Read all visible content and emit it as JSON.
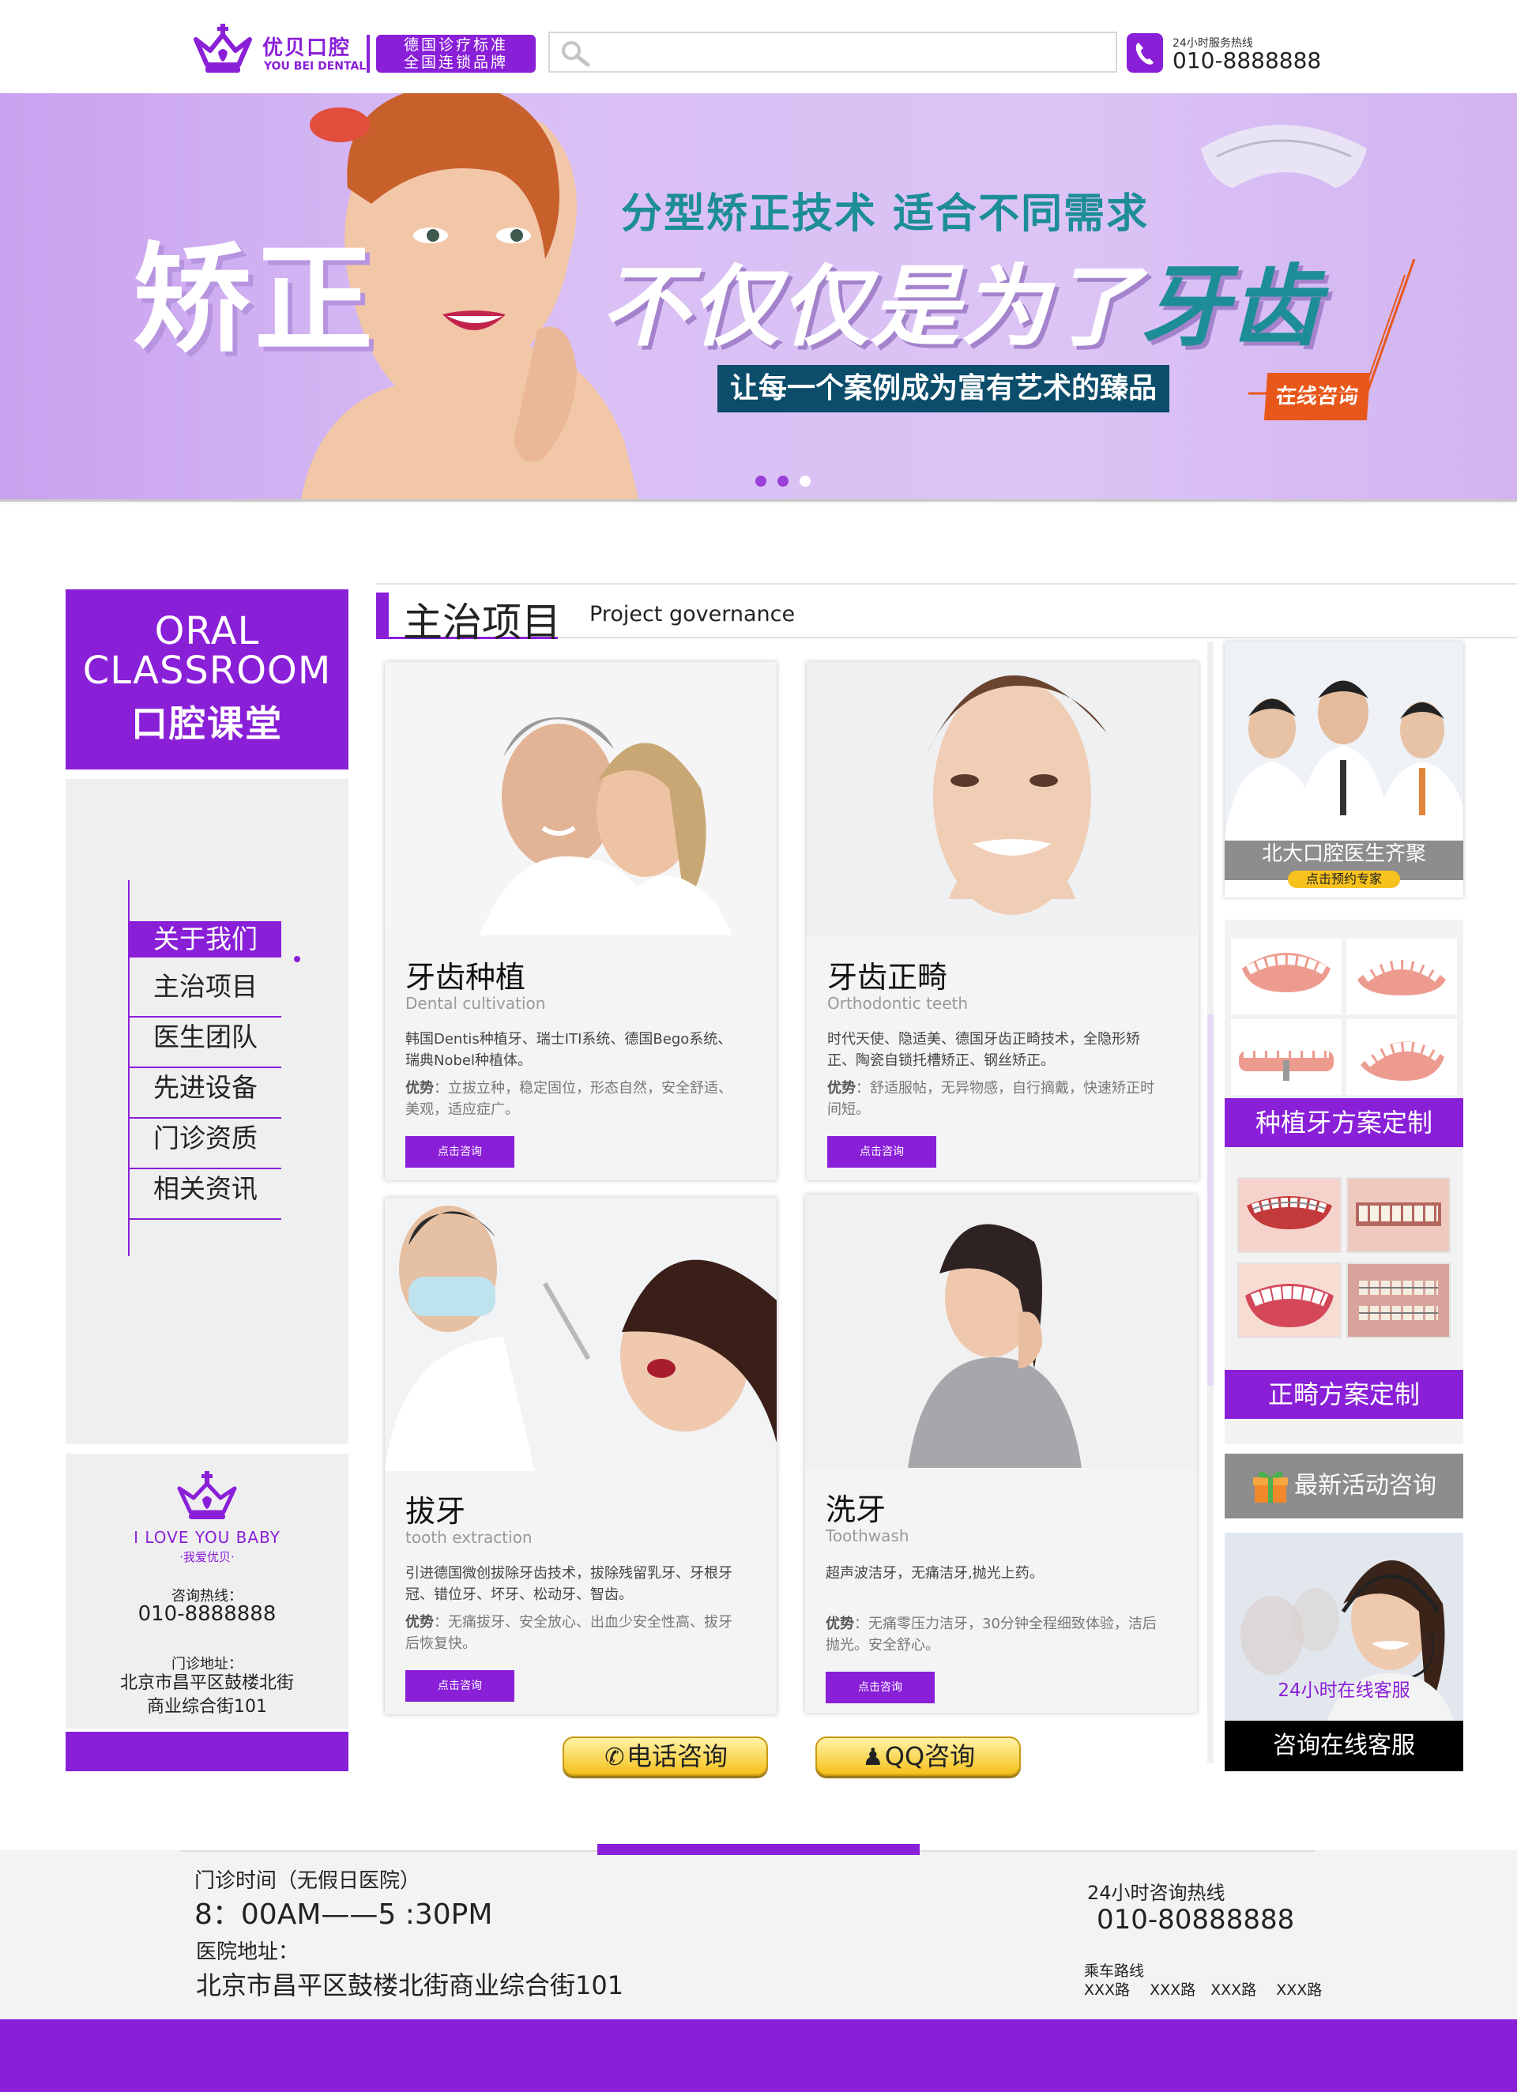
{
  "header": {
    "logo_cn": "优贝口腔",
    "logo_en": "YOU BEI DENTAL",
    "slogan_line1": "德国诊疗标准",
    "slogan_line2": "全国连锁品牌",
    "search_placeholder": "",
    "hotline_label": "24小时服务热线",
    "hotline_number": "010-8888888"
  },
  "banner": {
    "big_word": "矫正",
    "sub_title": "分型矫正技术 适合不同需求",
    "headline_a": "不仅仅是为了",
    "headline_b": "牙齿",
    "tagline": "让每一个案例成为富有艺术的臻品",
    "cta": "在线咨询",
    "slides": 3,
    "active_slide": 3
  },
  "sidebar": {
    "title_en_1": "ORAL",
    "title_en_2": "CLASSROOM",
    "title_cn": "口腔课堂",
    "nav": [
      {
        "label": "关于我们",
        "active": true
      },
      {
        "label": "主治项目",
        "active": false
      },
      {
        "label": "医生团队",
        "active": false
      },
      {
        "label": "先进设备",
        "active": false
      },
      {
        "label": "门诊资质",
        "active": false
      },
      {
        "label": "相关资讯",
        "active": false
      }
    ],
    "contact": {
      "love": "I LOVE YOU BABY",
      "love_cn": "·我爱优贝·",
      "hotline_label": "咨询热线：",
      "hotline": "010-8888888",
      "addr_label": "门诊地址：",
      "addr_line1": "北京市昌平区鼓楼北街",
      "addr_line2": "商业综合街101"
    }
  },
  "main": {
    "heading_cn": "主治项目",
    "heading_en": "Project governance",
    "cards": [
      {
        "title": "牙齿种植",
        "subtitle": "Dental cultivation",
        "desc": "韩国Dentis种植牙、瑞士ITI系统、德国Bego系统、瑞典Nobel种植体。",
        "adv_label": "优势",
        "adv": "：立拔立种，稳定固位，形态自然，安全舒适、美观，适应症广。",
        "button": "点击咨询"
      },
      {
        "title": "牙齿正畸",
        "subtitle": "Orthodontic teeth",
        "desc": "时代天使、隐适美、德国牙齿正畸技术，全隐形矫正、陶瓷自锁托槽矫正、钢丝矫正。",
        "adv_label": "优势",
        "adv": "：舒适服帖，无异物感，自行摘戴，快速矫正时间短。",
        "button": "点击咨询"
      },
      {
        "title": "拔牙",
        "subtitle": "tooth extraction",
        "desc": "引进德国微创拔除牙齿技术，拔除残留乳牙、牙根牙冠、错位牙、坏牙、松动牙、智齿。",
        "adv_label": "优势",
        "adv": "：无痛拔牙、安全放心、出血少安全性高、拔牙后恢复快。",
        "button": "点击咨询"
      },
      {
        "title": "洗牙",
        "subtitle": "Toothwash",
        "desc": "超声波洁牙，无痛洁牙,抛光上药。",
        "adv_label": "优势",
        "adv": "：无痛零压力洁牙，30分钟全程细致体验，洁后抛光。安全舒心。",
        "button": "点击咨询"
      }
    ],
    "phone_consult": "电话咨询",
    "qq_consult": "QQ咨询"
  },
  "right": {
    "doctors_label": "北大口腔医生齐聚",
    "doctors_pill": "点击预约专家",
    "implant_label": "种植牙方案定制",
    "ortho_label": "正畸方案定制",
    "activity_label": "最新活动咨询",
    "service_text": "24小时在线客服",
    "service_bar": "咨询在线客服"
  },
  "footer": {
    "hours_label": "门诊时间（无假日医院）",
    "hours": "8：00AM——5 :30PM",
    "addr_label": "医院地址：",
    "addr": "北京市昌平区鼓楼北街商业综合街101",
    "hotline_label": "24小时咨询热线",
    "hotline": "010-80888888",
    "bus_label": "乘车路线",
    "bus_routes": "XXX路　 XXX路　XXX路　 XXX路"
  },
  "colors": {
    "brand_purple": "#8a1fd8",
    "teal": "#1d8d97",
    "orange": "#e8571a"
  }
}
